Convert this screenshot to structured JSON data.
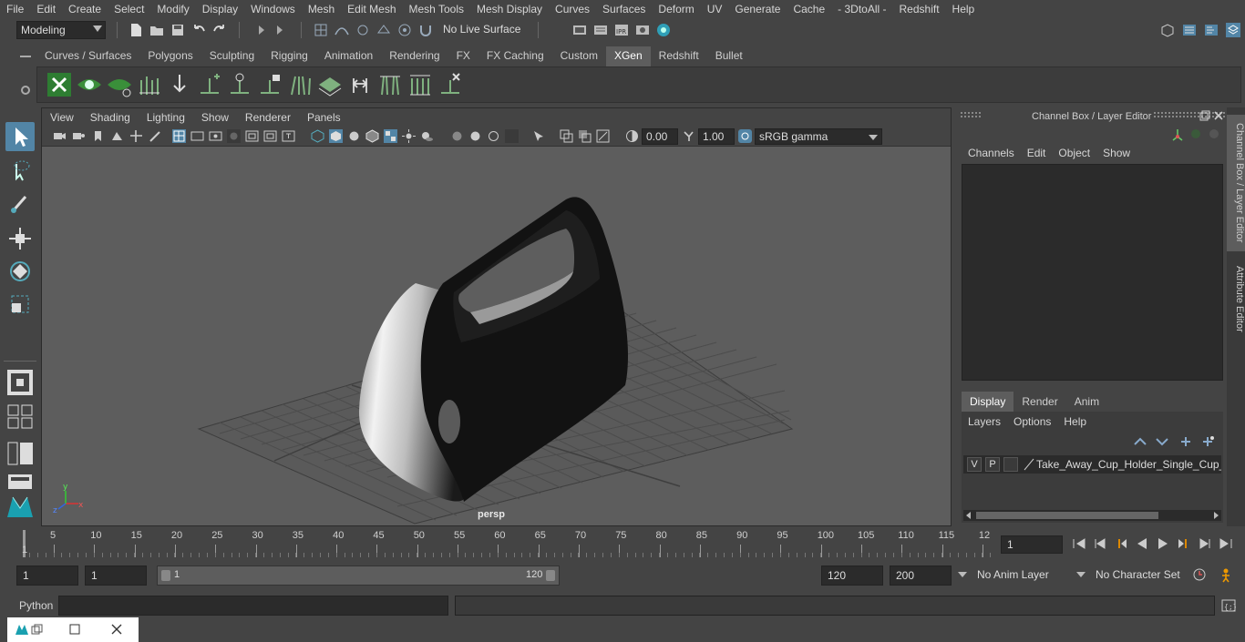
{
  "menubar": {
    "items": [
      "File",
      "Edit",
      "Create",
      "Select",
      "Modify",
      "Display",
      "Windows",
      "Mesh",
      "Edit Mesh",
      "Mesh Tools",
      "Mesh Display",
      "Curves",
      "Surfaces",
      "Deform",
      "UV",
      "Generate",
      "Cache",
      "- 3DtoAll -",
      "Redshift",
      "Help"
    ]
  },
  "statusline": {
    "mode": "Modeling",
    "live_surface": "No Live Surface"
  },
  "shelf": {
    "tabs": [
      "Curves / Surfaces",
      "Polygons",
      "Sculpting",
      "Rigging",
      "Animation",
      "Rendering",
      "FX",
      "FX Caching",
      "Custom",
      "XGen",
      "Redshift",
      "Bullet"
    ],
    "active_tab": "XGen"
  },
  "viewport": {
    "menu": [
      "View",
      "Shading",
      "Lighting",
      "Show",
      "Renderer",
      "Panels"
    ],
    "exposure": "0.00",
    "gamma": "1.00",
    "color_space": "sRGB gamma",
    "camera_label": "persp",
    "axis_x": "x",
    "axis_y": "y",
    "axis_z": "z"
  },
  "channelbox": {
    "title": "Channel Box / Layer Editor",
    "menu": [
      "Channels",
      "Edit",
      "Object",
      "Show"
    ]
  },
  "sidetabs": [
    "Channel Box / Layer Editor",
    "Attribute Editor"
  ],
  "layereditor": {
    "tabs": [
      "Display",
      "Render",
      "Anim"
    ],
    "active_tab": "Display",
    "menu": [
      "Layers",
      "Options",
      "Help"
    ],
    "layer": {
      "v": "V",
      "p": "P",
      "name": "Take_Away_Cup_Holder_Single_Cup_Bla"
    }
  },
  "timeslider": {
    "ticks": [
      "5",
      "10",
      "15",
      "20",
      "25",
      "30",
      "35",
      "40",
      "45",
      "50",
      "55",
      "60",
      "65",
      "70",
      "75",
      "80",
      "85",
      "90",
      "95",
      "100",
      "105",
      "110",
      "115",
      "12"
    ],
    "start_label": "1",
    "current_frame": "1"
  },
  "range": {
    "start": "1",
    "playback_start": "1",
    "range_start_label": "1",
    "range_end_label": "120",
    "playback_end": "120",
    "end": "200",
    "anim_layer": "No Anim Layer",
    "character_set": "No Character Set"
  },
  "commandline": {
    "language": "Python"
  },
  "colors": {
    "accent": "#5285a6",
    "bg": "#444444",
    "viewport": "#5d5d5d"
  }
}
